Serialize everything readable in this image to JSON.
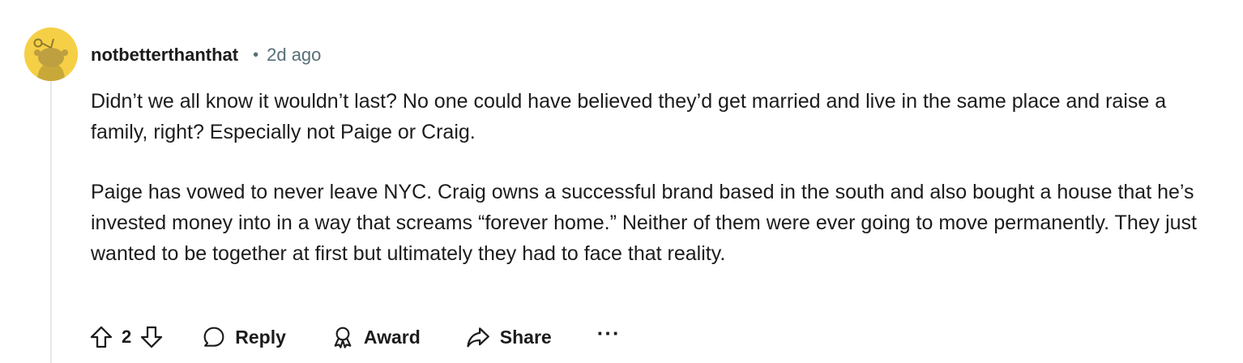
{
  "comment": {
    "author": "notbetterthanthat",
    "separator": "•",
    "timestamp": "2d ago",
    "paragraphs": [
      "Didn’t we all know it wouldn’t last? No one could have believed they’d get married and live in the same place and raise a family, right? Especially not Paige or Craig.",
      "Paige has vowed to never leave NYC. Craig owns a successful brand based in the south and also bought a house that he’s invested money into in a way that screams “forever home.” Neither of them were ever going to move permanently. They just wanted to be together at first but ultimately they had to face that reality."
    ],
    "score": "2",
    "actions": {
      "reply": "Reply",
      "award": "Award",
      "share": "Share",
      "more": "···"
    }
  },
  "icons": {
    "avatar": "snoo-avatar-icon",
    "upvote": "upvote-arrow-icon",
    "downvote": "downvote-arrow-icon",
    "reply": "speech-bubble-icon",
    "award": "award-ribbon-icon",
    "share": "share-arrow-icon",
    "more": "ellipsis-icon"
  },
  "colors": {
    "avatar_background": "#f5cf45",
    "text": "#1c1c1c",
    "meta": "#576f76",
    "thread_line": "#e5e7e9"
  }
}
